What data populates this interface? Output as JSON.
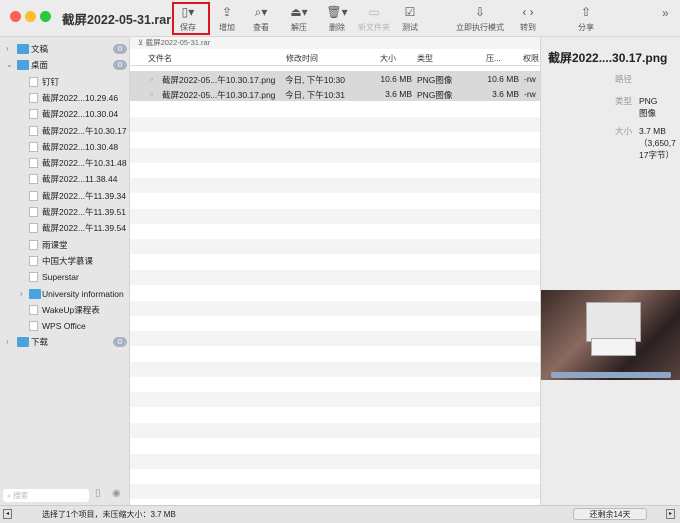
{
  "window": {
    "title": "截屏2022-05-31.rar"
  },
  "toolbar": [
    {
      "label": "保存",
      "icon": "archive-save-icon"
    },
    {
      "label": "增加",
      "icon": "add-icon"
    },
    {
      "label": "查看",
      "icon": "view-icon"
    },
    {
      "label": "解压",
      "icon": "extract-icon"
    },
    {
      "label": "删除",
      "icon": "trash-icon"
    },
    {
      "label": "新文件夹",
      "icon": "new-folder-icon"
    },
    {
      "label": "测试",
      "icon": "test-checkbox-icon"
    },
    {
      "label": "立即执行模式",
      "icon": "immediate-mode-icon"
    },
    {
      "label": "转到",
      "icon": "back-forward-icon"
    },
    {
      "label": "分享",
      "icon": "share-icon"
    }
  ],
  "sidebar": {
    "items": [
      {
        "label": "文稿",
        "badge": "0",
        "kind": "folder"
      },
      {
        "label": "桌面",
        "badge": "0",
        "kind": "folder"
      },
      {
        "label": "钉钉",
        "kind": "app"
      },
      {
        "label": "截屏2022...10.29.46",
        "kind": "file"
      },
      {
        "label": "截屏2022...10.30.04",
        "kind": "file"
      },
      {
        "label": "截屏2022...午10.30.17",
        "kind": "file"
      },
      {
        "label": "截屏2022...10.30.48",
        "kind": "file"
      },
      {
        "label": "截屏2022...午10.31.48",
        "kind": "file"
      },
      {
        "label": "截屏2022...11.38.44",
        "kind": "file"
      },
      {
        "label": "截屏2022...午11.39.34",
        "kind": "file"
      },
      {
        "label": "截屏2022...午11.39.51",
        "kind": "file"
      },
      {
        "label": "截屏2022...午11.39.54",
        "kind": "file"
      },
      {
        "label": "雨课堂",
        "kind": "app"
      },
      {
        "label": "中国大学慕课",
        "kind": "app"
      },
      {
        "label": "Superstar",
        "kind": "app"
      },
      {
        "label": "University information",
        "kind": "folder"
      },
      {
        "label": "WakeUp课程表",
        "kind": "app"
      },
      {
        "label": "WPS Office",
        "kind": "app"
      },
      {
        "label": "下载",
        "badge": "0",
        "kind": "folder"
      }
    ],
    "search_placeholder": "搜索"
  },
  "main": {
    "breadcrumb": "截屏2022-05-31.rar",
    "columns": [
      "文件名",
      "修改时间",
      "大小",
      "类型",
      "压...",
      "权限"
    ],
    "rows": [
      {
        "name": "截屏2022-05...午10.30.17.png",
        "modified": "今日, 下午10:30",
        "size": "10.6 MB",
        "type": "PNG图像",
        "packed": "10.6 MB",
        "perm": "-rw"
      },
      {
        "name": "截屏2022-05...午10.30.17.png",
        "modified": "今日, 下午10:31",
        "size": "3.6 MB",
        "type": "PNG图像",
        "packed": "3.6 MB",
        "perm": "-rw"
      }
    ]
  },
  "preview": {
    "title": "截屏2022....30.17.png",
    "path_label": "路径",
    "type_label": "类型",
    "type_value": "PNG图像",
    "size_label": "大小",
    "size_value": "3.7 MB（3,650,717字节）"
  },
  "status": {
    "text": "选择了1个项目，未压缩大小：3.7 MB",
    "trial": "还剩余14天"
  }
}
